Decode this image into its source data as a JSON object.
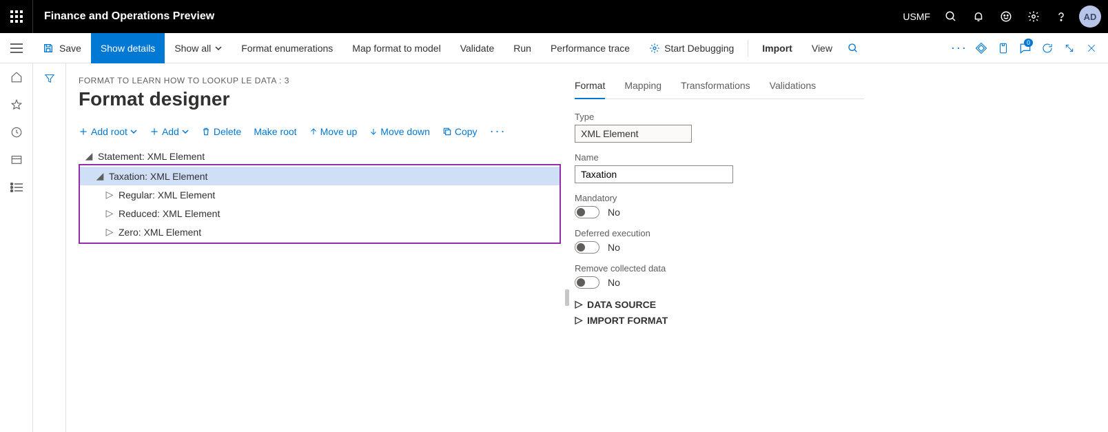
{
  "topbar": {
    "title": "Finance and Operations Preview",
    "company": "USMF",
    "avatar": "AD"
  },
  "actions": {
    "save": "Save",
    "show_details": "Show details",
    "show_all": "Show all",
    "format_enum": "Format enumerations",
    "map": "Map format to model",
    "validate": "Validate",
    "run": "Run",
    "perf": "Performance trace",
    "debug": "Start Debugging",
    "import": "Import",
    "view": "View",
    "badge": "0"
  },
  "page": {
    "breadcrumb": "FORMAT TO LEARN HOW TO LOOKUP LE DATA : 3",
    "title": "Format designer"
  },
  "toolbar": {
    "add_root": "Add root",
    "add": "Add",
    "delete": "Delete",
    "make_root": "Make root",
    "move_up": "Move up",
    "move_down": "Move down",
    "copy": "Copy"
  },
  "tree": {
    "root": "Statement: XML Element",
    "selected": "Taxation: XML Element",
    "children": [
      "Regular: XML Element",
      "Reduced: XML Element",
      "Zero: XML Element"
    ]
  },
  "tabs": [
    "Format",
    "Mapping",
    "Transformations",
    "Validations"
  ],
  "props": {
    "type_label": "Type",
    "type_value": "XML Element",
    "name_label": "Name",
    "name_value": "Taxation",
    "mandatory_label": "Mandatory",
    "mandatory_value": "No",
    "deferred_label": "Deferred execution",
    "deferred_value": "No",
    "remove_label": "Remove collected data",
    "remove_value": "No",
    "data_source": "DATA SOURCE",
    "import_format": "IMPORT FORMAT"
  }
}
